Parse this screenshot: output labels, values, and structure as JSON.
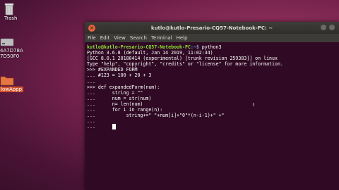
{
  "desktop": {
    "icons": [
      {
        "label": "Trash"
      },
      {
        "label_line1": "4A7D78A",
        "label_line2": "7D50F0"
      },
      {
        "label": "lowAppp"
      }
    ]
  },
  "window": {
    "title": "kutlo@kutlo-Presario-CQ57-Notebook-PC: ~",
    "menu": [
      "File",
      "Edit",
      "View",
      "Search",
      "Terminal",
      "Help"
    ]
  },
  "terminal": {
    "prompt_user": "kutlo@kutlo-Presario-CQ57-Notebook-PC",
    "prompt_path": ":~$",
    "command": " python3",
    "lines": [
      "Python 3.6.8 (default, Jan 14 2019, 11:02:34)",
      "[GCC 8.0.1 20180414 (experimental) [trunk revision 259383]] on linux",
      "Type \"help\", \"copyright\", \"credits\" or \"license\" for more information.",
      ">>> #EXPANDED FORM",
      "... #123 = 100 + 20 + 3",
      "...",
      ">>> def expandedForm(num):",
      "...      string = \"\"",
      "...      num = str(num)",
      "...      n= len(num)",
      "...      for i in range(n):",
      "...           string+=\" \"+num[i]+\"0\"*(n-i-1)+\" +\"",
      "...",
      "..."
    ]
  }
}
